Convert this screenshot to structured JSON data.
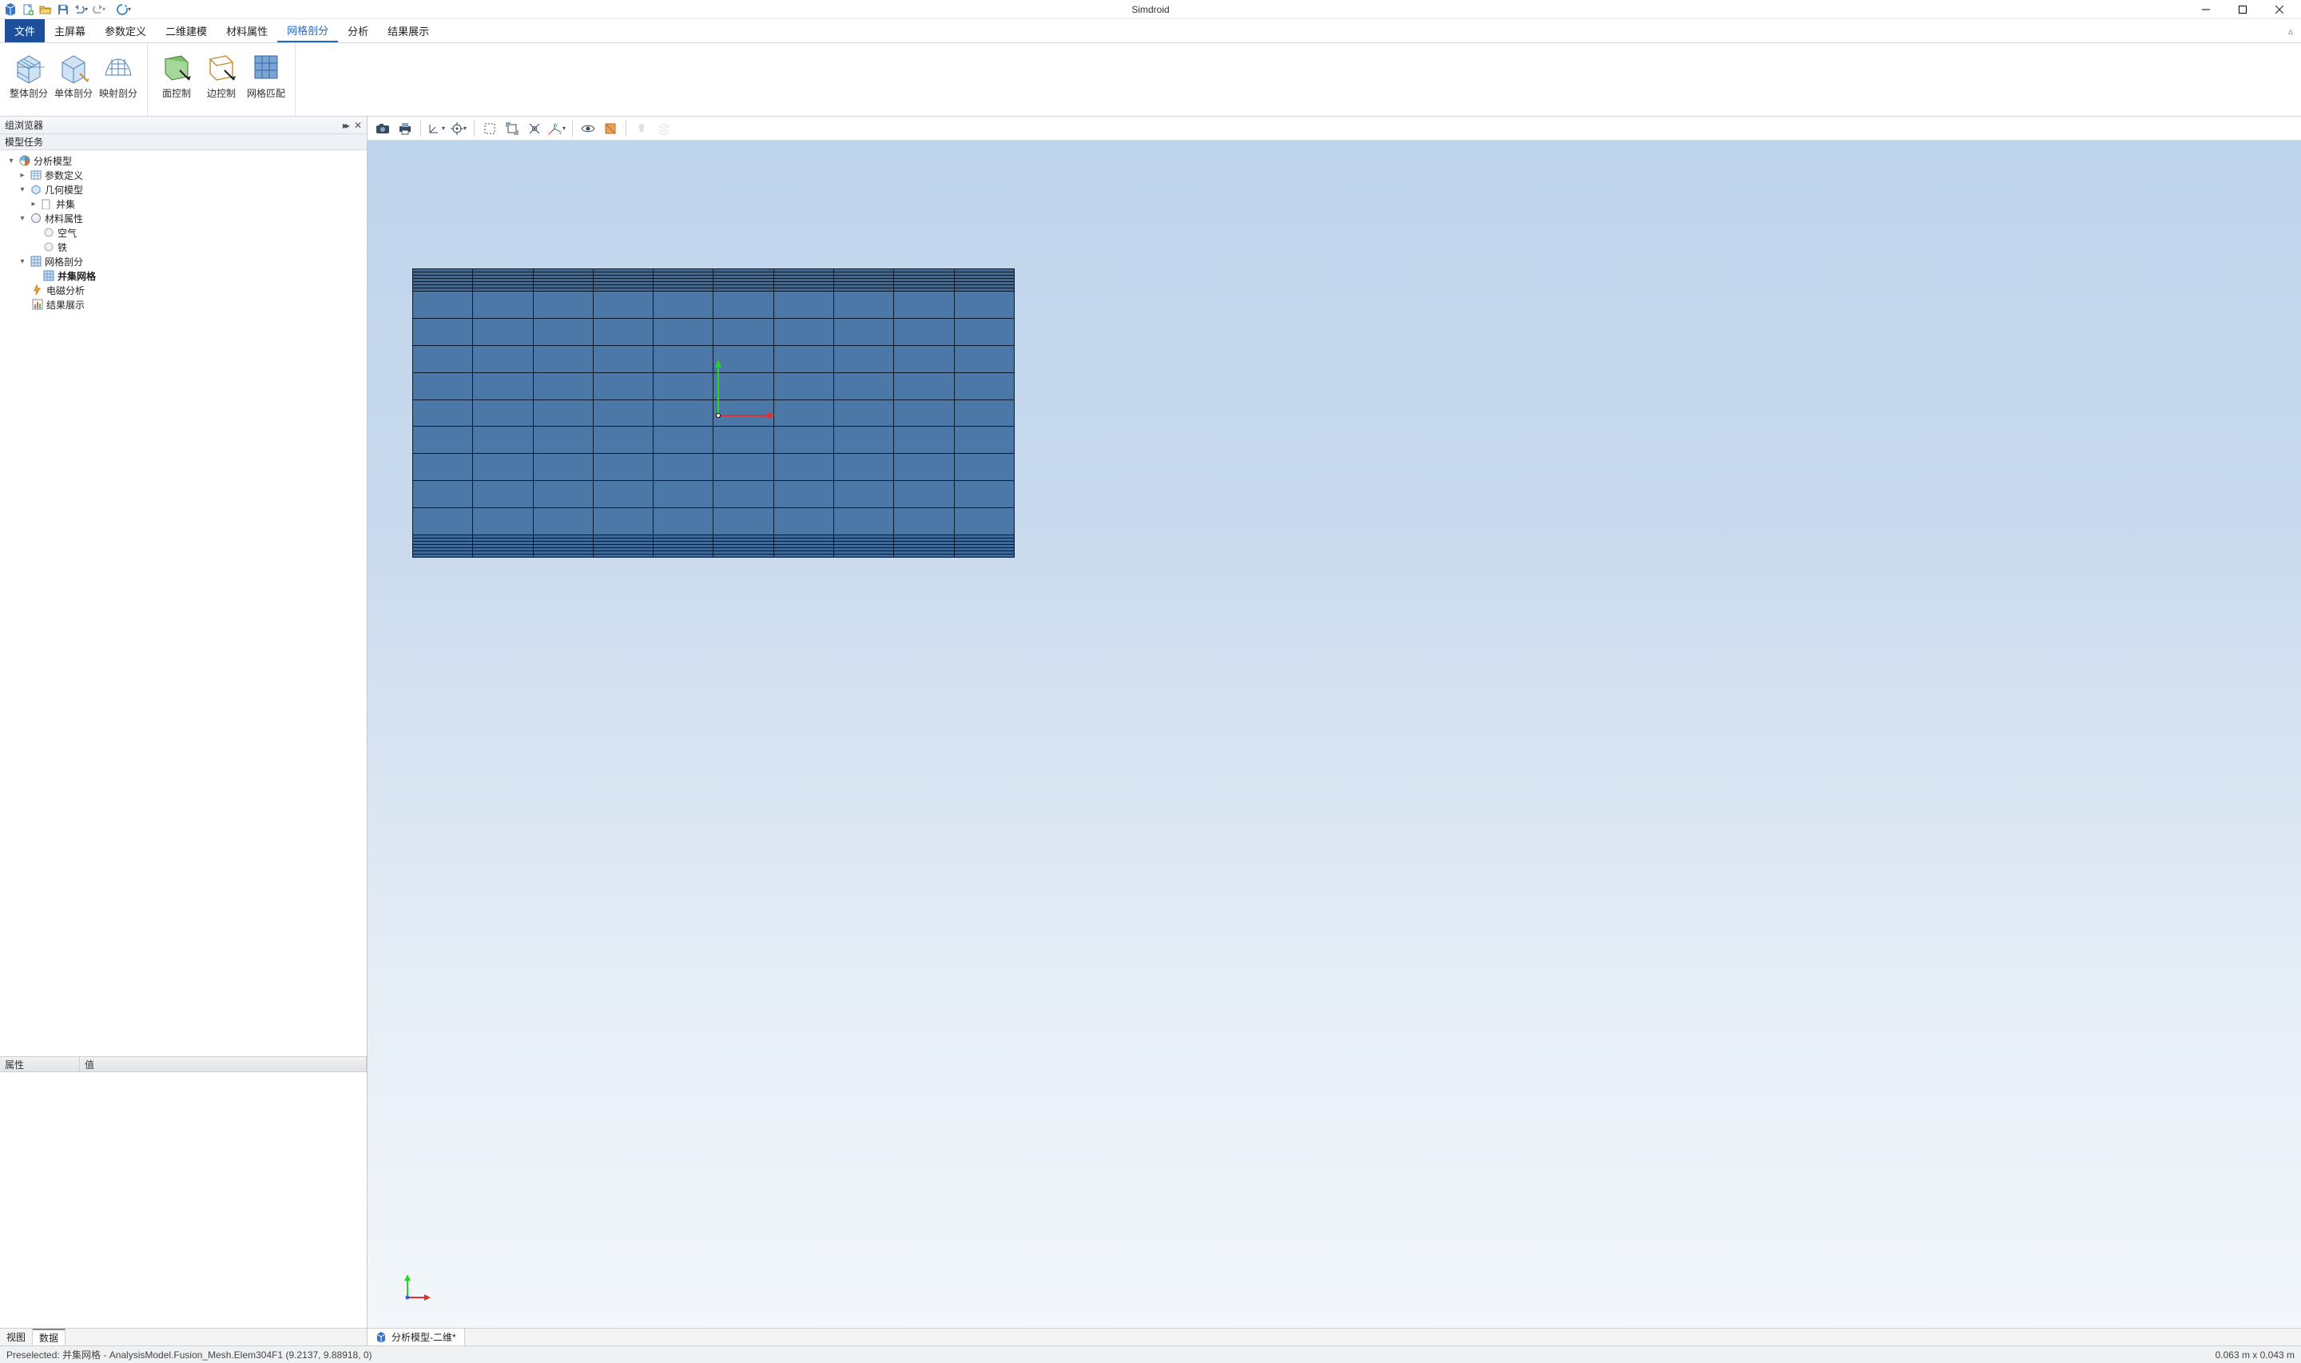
{
  "app": {
    "title": "Simdroid"
  },
  "qat": [
    "new",
    "open",
    "save",
    "undo",
    "redo",
    "refresh"
  ],
  "ribbon": {
    "tabs": {
      "file": "文件",
      "home": "主屏幕",
      "param": "参数定义",
      "model": "二维建模",
      "mat": "材料属性",
      "mesh": "网格剖分",
      "anal": "分析",
      "result": "结果展示"
    },
    "active": "mesh",
    "buttons": {
      "whole": "整体剖分",
      "single": "单体剖分",
      "map": "映射剖分",
      "face": "面控制",
      "edge": "边控制",
      "match": "网格匹配"
    }
  },
  "panel": {
    "browser_title": "组浏览器",
    "task_title": "模型任务",
    "props": {
      "col_attr": "属性",
      "col_val": "值"
    },
    "bottom": {
      "view": "视图",
      "data": "数据",
      "active": "data"
    }
  },
  "tree": {
    "root": "分析模型",
    "param_def": "参数定义",
    "geom": "几何模型",
    "union": "并集",
    "material": "材料属性",
    "air": "空气",
    "iron": "铁",
    "mesh": "网格剖分",
    "union_mesh": "并集网格",
    "em": "电磁分析",
    "result": "结果展示"
  },
  "viewport": {
    "tab_label": "分析模型-二维*"
  },
  "status": {
    "msg": "Preselected: 并集网格 - AnalysisModel.Fusion_Mesh.Elem304F1 (9.2137, 9.88918, 0)",
    "dim": "0.063 m x 0.043 m"
  }
}
